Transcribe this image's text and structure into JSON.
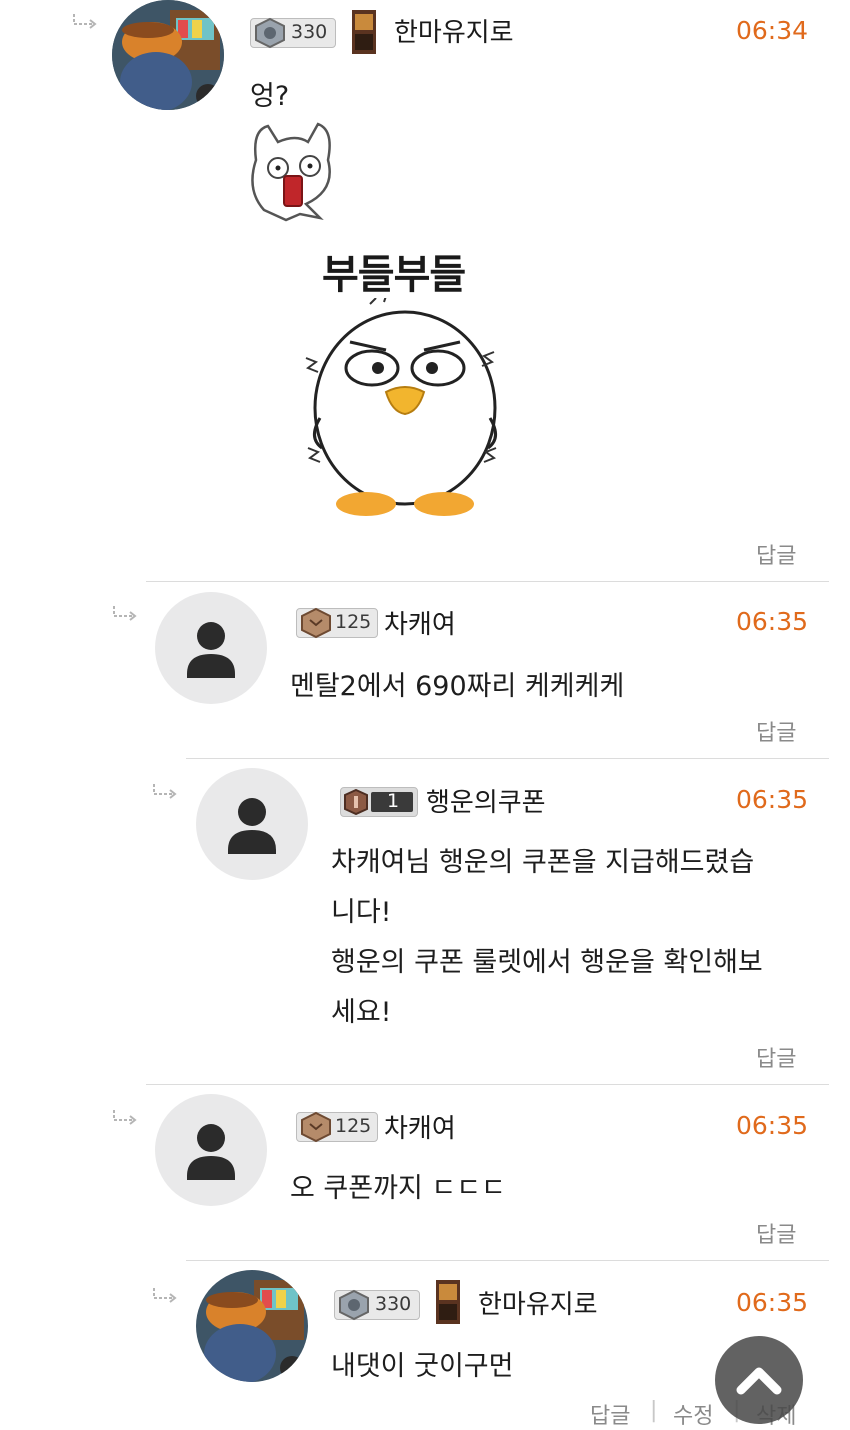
{
  "comments": [
    {
      "nickname": "한마유지로",
      "level": "330",
      "time": "06:34",
      "text": "엉?",
      "sticker_text": "부들부들",
      "actions": {
        "reply": "답글"
      }
    },
    {
      "nickname": "차캐여",
      "level": "125",
      "time": "06:35",
      "text": "멘탈2에서 690짜리 케케케케",
      "actions": {
        "reply": "답글"
      }
    },
    {
      "nickname": "행운의쿠폰",
      "level": "1",
      "time": "06:35",
      "lines": [
        "차캐여님 행운의 쿠폰을 지급해드렸습",
        "니다!",
        "행운의 쿠폰 룰렛에서 행운을 확인해보",
        "세요!"
      ],
      "actions": {
        "reply": "답글"
      }
    },
    {
      "nickname": "차캐여",
      "level": "125",
      "time": "06:35",
      "text": "오 쿠폰까지 ㄷㄷㄷ",
      "actions": {
        "reply": "답글"
      }
    },
    {
      "nickname": "한마유지로",
      "level": "330",
      "time": "06:35",
      "text": "내댓이 굿이구먼",
      "actions": {
        "reply": "답글",
        "edit": "수정",
        "delete": "삭제"
      }
    }
  ],
  "icons": {
    "reply_arrow": "reply-arrow-icon",
    "default_avatar": "user-silhouette-icon",
    "scroll_top": "chevron-up-icon"
  },
  "colors": {
    "time": "#e06a1c",
    "divider": "#dcdcdc",
    "avatar_bg": "#e9e9ea"
  }
}
